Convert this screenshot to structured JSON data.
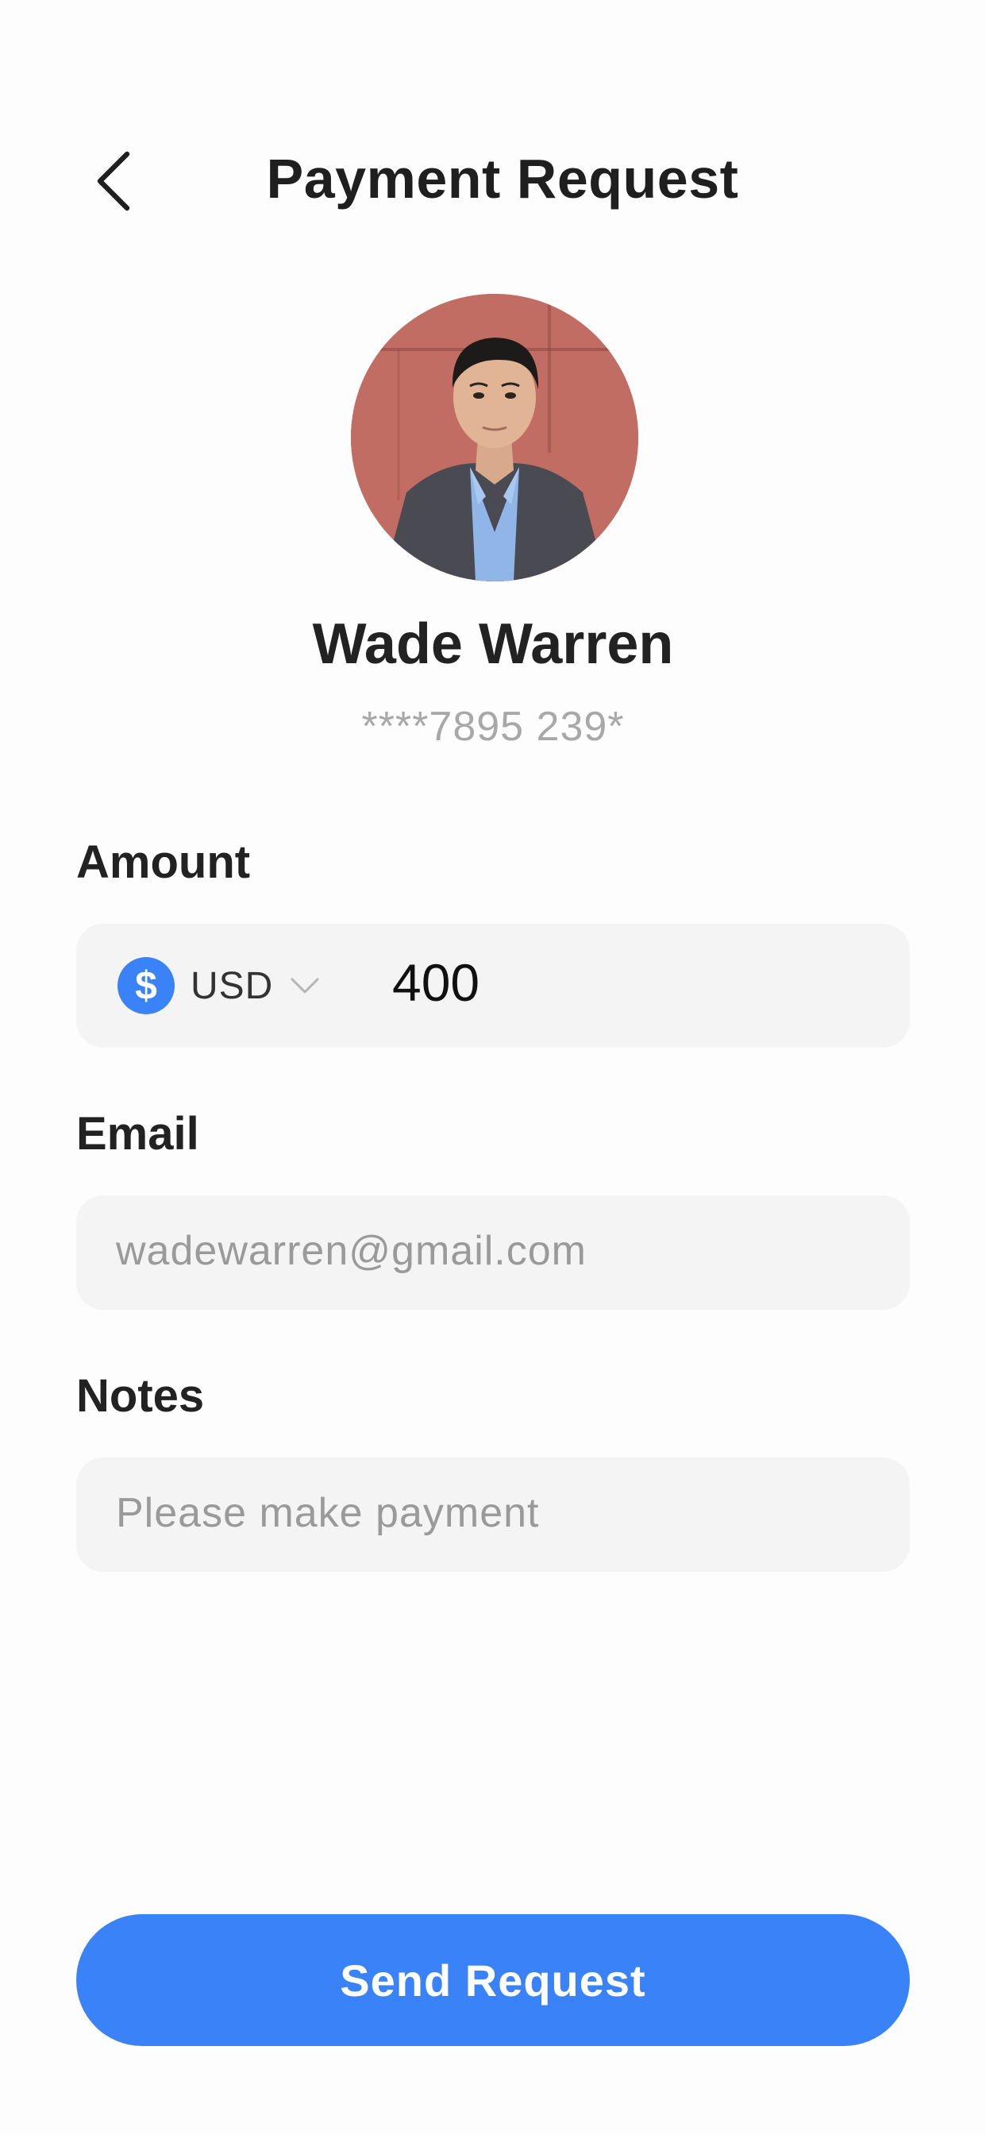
{
  "header": {
    "title": "Payment Request",
    "back_icon": "chevron-left-icon"
  },
  "recipient": {
    "name": "Wade Warren",
    "account": "****7895 239*"
  },
  "form": {
    "amount": {
      "label": "Amount",
      "currency_symbol": "$",
      "currency_code": "USD",
      "value": "400"
    },
    "email": {
      "label": "Email",
      "value": "wadewarren@gmail.com"
    },
    "notes": {
      "label": "Notes",
      "value": "Please make payment"
    }
  },
  "actions": {
    "send_label": "Send Request"
  },
  "colors": {
    "accent": "#3a82f7",
    "field_background": "#f4f4f4",
    "muted_text": "#a8a8a8"
  }
}
